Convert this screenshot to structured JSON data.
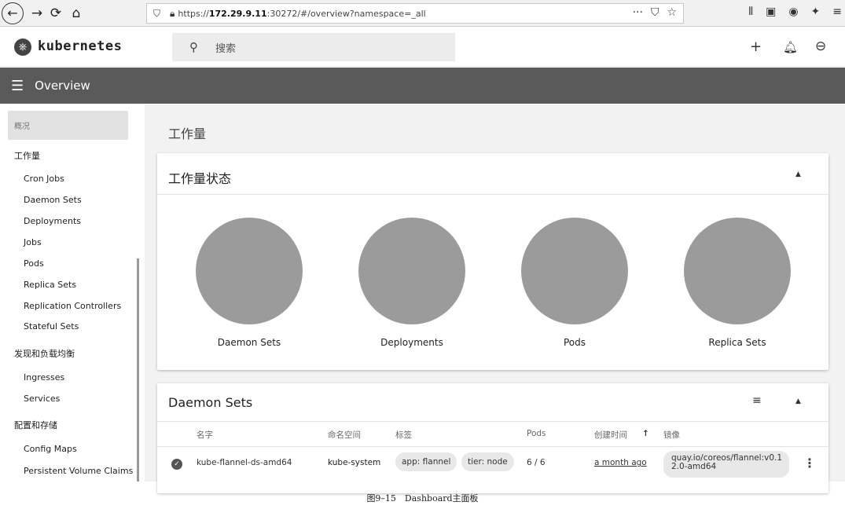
{
  "browser": {
    "url_prefix": "https://",
    "url_host": "172.29.9.11",
    "url_rest": ":30272/#/overview?namespace=_all",
    "more": "···"
  },
  "header": {
    "logo_text": "kubernetes",
    "search_placeholder": "搜索"
  },
  "toolbar": {
    "title": "Overview"
  },
  "sidebar": {
    "items": [
      {
        "label": "概况"
      },
      {
        "label": "工作量"
      },
      {
        "label": "Cron Jobs"
      },
      {
        "label": "Daemon Sets"
      },
      {
        "label": "Deployments"
      },
      {
        "label": "Jobs"
      },
      {
        "label": "Pods"
      },
      {
        "label": "Replica Sets"
      },
      {
        "label": "Replication Controllers"
      },
      {
        "label": "Stateful Sets"
      },
      {
        "label": "发现和负载均衡"
      },
      {
        "label": "Ingresses"
      },
      {
        "label": "Services"
      },
      {
        "label": "配置和存储"
      },
      {
        "label": "Config Maps"
      },
      {
        "label": "Persistent Volume Claims"
      }
    ]
  },
  "main": {
    "page_title": "工作量",
    "status_card": {
      "title": "工作量状态",
      "items": [
        {
          "label": "Daemon Sets"
        },
        {
          "label": "Deployments"
        },
        {
          "label": "Pods"
        },
        {
          "label": "Replica Sets"
        }
      ]
    },
    "daemon_card": {
      "title": "Daemon Sets",
      "columns": {
        "name": "名字",
        "namespace": "命名空间",
        "labels": "标签",
        "pods": "Pods",
        "created": "创建时间",
        "image": "镜像"
      },
      "sort_arrow": "↑",
      "rows": [
        {
          "name": "kube-flannel-ds-amd64",
          "namespace": "kube-system",
          "label1": "app: flannel",
          "label2": "tier: node",
          "pods": "6 / 6",
          "created": "a month ago",
          "image_line1": "quay.io/coreos/flannel:v0.1",
          "image_line2": "2.0-amd64"
        }
      ]
    }
  },
  "caption": "图9–15　Dashboard主面板",
  "colors": {
    "toolbar": "#5a5a5a",
    "circle": "#9b9b9b",
    "chip": "#e8e8e8"
  }
}
